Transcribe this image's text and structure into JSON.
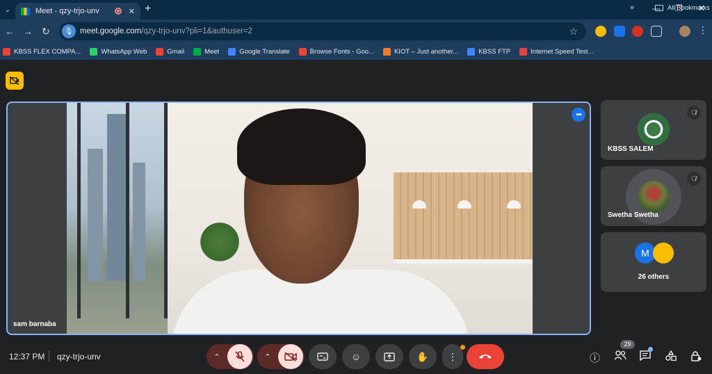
{
  "browser": {
    "tab_title": "Meet - qzy-trjo-unv",
    "tab_close": "✕",
    "new_tab": "+",
    "url_host": "meet.google.com",
    "url_path": "/qzy-trjo-unv?pli=1&authuser=2",
    "bookmarks": [
      {
        "label": "KBSS FLEX COMPA...",
        "color": "#ea4335"
      },
      {
        "label": "WhatsApp Web",
        "color": "#25d366"
      },
      {
        "label": "Gmail",
        "color": "#ea4335"
      },
      {
        "label": "Meet",
        "color": "#00ac47"
      },
      {
        "label": "Google Translate",
        "color": "#4285f4"
      },
      {
        "label": "Browse Fonts - Goo...",
        "color": "#ea4335"
      },
      {
        "label": "KIOT – Just another...",
        "color": "#f47b20"
      },
      {
        "label": "KBSS FTP",
        "color": "#4285f4"
      },
      {
        "label": "Internet Speed Test...",
        "color": "#ea4335"
      }
    ],
    "bookmarks_more": "»",
    "all_bookmarks": "All Bookmarks"
  },
  "meet": {
    "main_participant": "sam barnaba",
    "more_options": "•••",
    "participants": [
      {
        "name": "KBSS SALEM"
      },
      {
        "name": "Swetha Swetha"
      }
    ],
    "others": {
      "avatar_letter": "M",
      "label": "26 others"
    },
    "bottom": {
      "time": "12:37 PM",
      "meeting_code": "qzy-trjo-unv",
      "people_count": "29"
    },
    "colors": {
      "accent": "#8ab4f8",
      "end_call": "#ea4335",
      "alert": "#fbbc04"
    }
  }
}
